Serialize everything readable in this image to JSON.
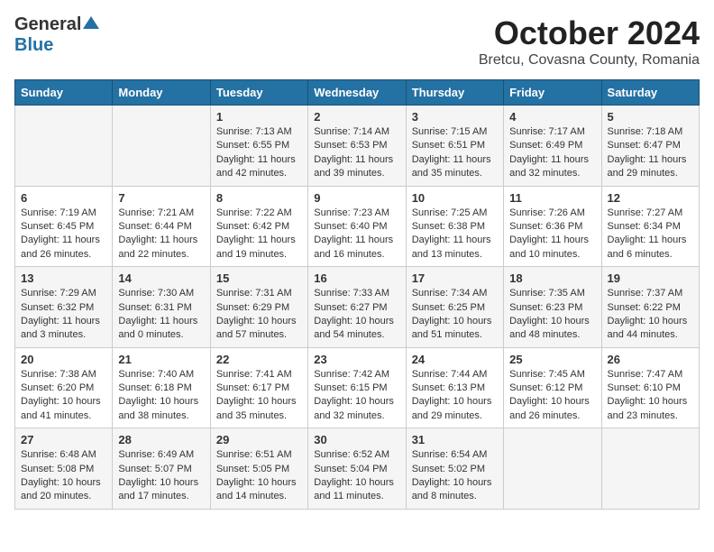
{
  "header": {
    "logo_general": "General",
    "logo_blue": "Blue",
    "month": "October 2024",
    "location": "Bretcu, Covasna County, Romania"
  },
  "weekdays": [
    "Sunday",
    "Monday",
    "Tuesday",
    "Wednesday",
    "Thursday",
    "Friday",
    "Saturday"
  ],
  "weeks": [
    [
      {
        "day": "",
        "content": ""
      },
      {
        "day": "",
        "content": ""
      },
      {
        "day": "1",
        "content": "Sunrise: 7:13 AM\nSunset: 6:55 PM\nDaylight: 11 hours and 42 minutes."
      },
      {
        "day": "2",
        "content": "Sunrise: 7:14 AM\nSunset: 6:53 PM\nDaylight: 11 hours and 39 minutes."
      },
      {
        "day": "3",
        "content": "Sunrise: 7:15 AM\nSunset: 6:51 PM\nDaylight: 11 hours and 35 minutes."
      },
      {
        "day": "4",
        "content": "Sunrise: 7:17 AM\nSunset: 6:49 PM\nDaylight: 11 hours and 32 minutes."
      },
      {
        "day": "5",
        "content": "Sunrise: 7:18 AM\nSunset: 6:47 PM\nDaylight: 11 hours and 29 minutes."
      }
    ],
    [
      {
        "day": "6",
        "content": "Sunrise: 7:19 AM\nSunset: 6:45 PM\nDaylight: 11 hours and 26 minutes."
      },
      {
        "day": "7",
        "content": "Sunrise: 7:21 AM\nSunset: 6:44 PM\nDaylight: 11 hours and 22 minutes."
      },
      {
        "day": "8",
        "content": "Sunrise: 7:22 AM\nSunset: 6:42 PM\nDaylight: 11 hours and 19 minutes."
      },
      {
        "day": "9",
        "content": "Sunrise: 7:23 AM\nSunset: 6:40 PM\nDaylight: 11 hours and 16 minutes."
      },
      {
        "day": "10",
        "content": "Sunrise: 7:25 AM\nSunset: 6:38 PM\nDaylight: 11 hours and 13 minutes."
      },
      {
        "day": "11",
        "content": "Sunrise: 7:26 AM\nSunset: 6:36 PM\nDaylight: 11 hours and 10 minutes."
      },
      {
        "day": "12",
        "content": "Sunrise: 7:27 AM\nSunset: 6:34 PM\nDaylight: 11 hours and 6 minutes."
      }
    ],
    [
      {
        "day": "13",
        "content": "Sunrise: 7:29 AM\nSunset: 6:32 PM\nDaylight: 11 hours and 3 minutes."
      },
      {
        "day": "14",
        "content": "Sunrise: 7:30 AM\nSunset: 6:31 PM\nDaylight: 11 hours and 0 minutes."
      },
      {
        "day": "15",
        "content": "Sunrise: 7:31 AM\nSunset: 6:29 PM\nDaylight: 10 hours and 57 minutes."
      },
      {
        "day": "16",
        "content": "Sunrise: 7:33 AM\nSunset: 6:27 PM\nDaylight: 10 hours and 54 minutes."
      },
      {
        "day": "17",
        "content": "Sunrise: 7:34 AM\nSunset: 6:25 PM\nDaylight: 10 hours and 51 minutes."
      },
      {
        "day": "18",
        "content": "Sunrise: 7:35 AM\nSunset: 6:23 PM\nDaylight: 10 hours and 48 minutes."
      },
      {
        "day": "19",
        "content": "Sunrise: 7:37 AM\nSunset: 6:22 PM\nDaylight: 10 hours and 44 minutes."
      }
    ],
    [
      {
        "day": "20",
        "content": "Sunrise: 7:38 AM\nSunset: 6:20 PM\nDaylight: 10 hours and 41 minutes."
      },
      {
        "day": "21",
        "content": "Sunrise: 7:40 AM\nSunset: 6:18 PM\nDaylight: 10 hours and 38 minutes."
      },
      {
        "day": "22",
        "content": "Sunrise: 7:41 AM\nSunset: 6:17 PM\nDaylight: 10 hours and 35 minutes."
      },
      {
        "day": "23",
        "content": "Sunrise: 7:42 AM\nSunset: 6:15 PM\nDaylight: 10 hours and 32 minutes."
      },
      {
        "day": "24",
        "content": "Sunrise: 7:44 AM\nSunset: 6:13 PM\nDaylight: 10 hours and 29 minutes."
      },
      {
        "day": "25",
        "content": "Sunrise: 7:45 AM\nSunset: 6:12 PM\nDaylight: 10 hours and 26 minutes."
      },
      {
        "day": "26",
        "content": "Sunrise: 7:47 AM\nSunset: 6:10 PM\nDaylight: 10 hours and 23 minutes."
      }
    ],
    [
      {
        "day": "27",
        "content": "Sunrise: 6:48 AM\nSunset: 5:08 PM\nDaylight: 10 hours and 20 minutes."
      },
      {
        "day": "28",
        "content": "Sunrise: 6:49 AM\nSunset: 5:07 PM\nDaylight: 10 hours and 17 minutes."
      },
      {
        "day": "29",
        "content": "Sunrise: 6:51 AM\nSunset: 5:05 PM\nDaylight: 10 hours and 14 minutes."
      },
      {
        "day": "30",
        "content": "Sunrise: 6:52 AM\nSunset: 5:04 PM\nDaylight: 10 hours and 11 minutes."
      },
      {
        "day": "31",
        "content": "Sunrise: 6:54 AM\nSunset: 5:02 PM\nDaylight: 10 hours and 8 minutes."
      },
      {
        "day": "",
        "content": ""
      },
      {
        "day": "",
        "content": ""
      }
    ]
  ]
}
